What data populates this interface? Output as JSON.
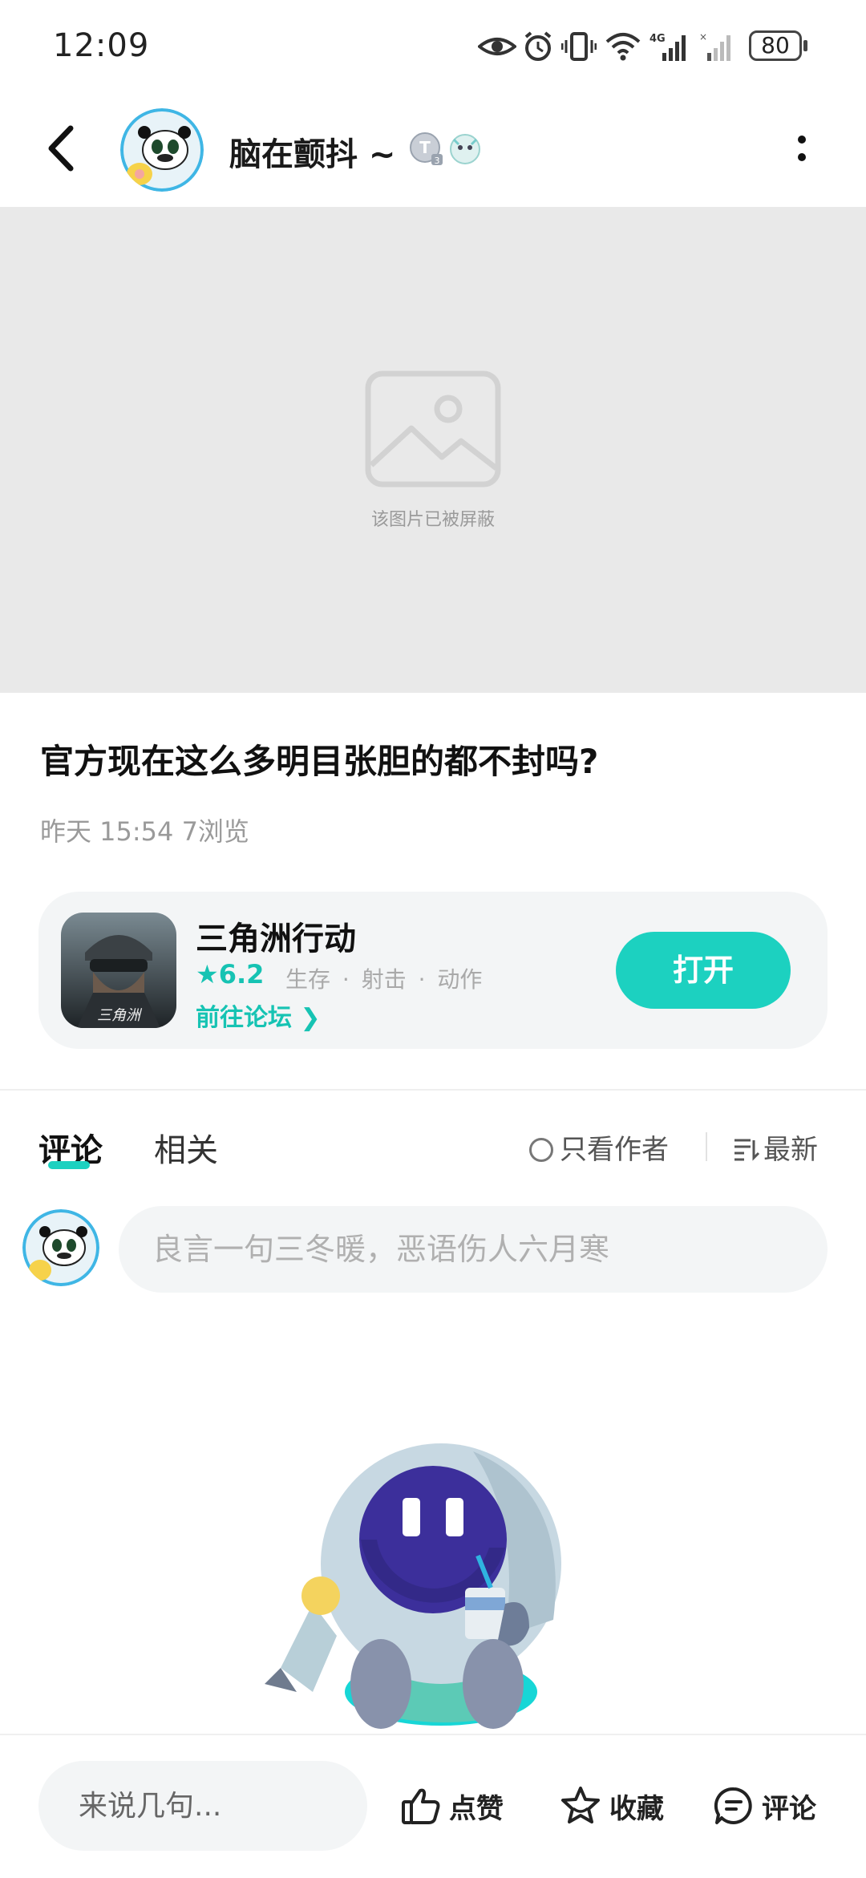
{
  "status_bar": {
    "time": "12:09",
    "battery": "80",
    "network": "4G"
  },
  "header": {
    "username": "脑在颤抖 ~",
    "badge_letter": "T",
    "badge_sub": "3"
  },
  "media": {
    "blocked_text": "该图片已被屏蔽"
  },
  "post": {
    "title": "官方现在这么多明目张胆的都不封吗?",
    "meta": "昨天 15:54  7浏览"
  },
  "game_card": {
    "name": "三角洲行动",
    "rating": "6.2",
    "tags": "生存 · 射击 · 动作",
    "forum_link": "前往论坛 ❯",
    "open_label": "打开",
    "icon_caption": "三角洲"
  },
  "tabs": {
    "comments": "评论",
    "related": "相关"
  },
  "filters": {
    "only_author": "只看作者",
    "sort": "最新"
  },
  "comment_input": {
    "placeholder": "良言一句三冬暖，恶语伤人六月寒"
  },
  "bottom_bar": {
    "input_placeholder": "来说几句...",
    "like": "点赞",
    "favorite": "收藏",
    "comment": "评论"
  },
  "colors": {
    "accent": "#1cd1c0",
    "rating": "#16c3b3",
    "media_bg": "#e9e9e9",
    "card_bg": "#f3f5f6"
  }
}
